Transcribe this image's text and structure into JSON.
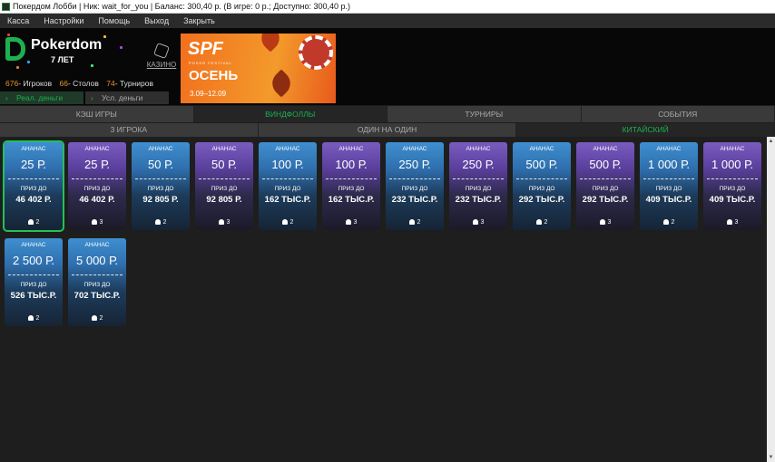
{
  "window": {
    "title": "Покердом Лобби | Ник: wait_for_you | Баланс: 300,40 р. (В игре: 0 р.; Доступно: 300,40 р.)"
  },
  "menu": [
    "Касса",
    "Настройки",
    "Помощь",
    "Выход",
    "Закрыть"
  ],
  "header": {
    "logo_text": "Pokerdom",
    "logo_sub": "7 ЛЕТ",
    "casino_label": "КАЗИНО",
    "stats": {
      "players_count": "676",
      "players_label": "- Игроков",
      "tables_count": "66",
      "tables_label": "- Столов",
      "tournaments_count": "74",
      "tournaments_label": "- Турниров"
    },
    "banner": {
      "title": "SPF",
      "fest": "POKER FESTIVAL",
      "season": "ОСЕНЬ",
      "dates": "3.09–12.09"
    }
  },
  "money_tabs": [
    {
      "label": "Реал. деньги",
      "active": true
    },
    {
      "label": "Усл. деньги",
      "active": false
    }
  ],
  "tabs": [
    {
      "label": "КЭШ ИГРЫ",
      "active": false
    },
    {
      "label": "ВИНДФОЛЛЫ",
      "active": true
    },
    {
      "label": "ТУРНИРЫ",
      "active": false
    },
    {
      "label": "СОБЫТИЯ",
      "active": false
    }
  ],
  "subtabs": [
    {
      "label": "3 ИГРОКА",
      "active": false
    },
    {
      "label": "ОДИН НА ОДИН",
      "active": false
    },
    {
      "label": "КИТАЙСКИЙ",
      "active": true
    }
  ],
  "prize_label": "ПРИЗ ДО",
  "cards": [
    {
      "game": "АНАНАС",
      "buyin": "25 Р.",
      "prize": "46 402 Р.",
      "players": "2",
      "color": "blue",
      "selected": true
    },
    {
      "game": "АНАНАС",
      "buyin": "25 Р.",
      "prize": "46 402 Р.",
      "players": "3",
      "color": "purple"
    },
    {
      "game": "АНАНАС",
      "buyin": "50 Р.",
      "prize": "92 805 Р.",
      "players": "2",
      "color": "blue"
    },
    {
      "game": "АНАНАС",
      "buyin": "50 Р.",
      "prize": "92 805 Р.",
      "players": "3",
      "color": "purple"
    },
    {
      "game": "АНАНАС",
      "buyin": "100 Р.",
      "prize": "162 ТЫС.Р.",
      "players": "2",
      "color": "blue"
    },
    {
      "game": "АНАНАС",
      "buyin": "100 Р.",
      "prize": "162 ТЫС.Р.",
      "players": "3",
      "color": "purple"
    },
    {
      "game": "АНАНАС",
      "buyin": "250 Р.",
      "prize": "232 ТЫС.Р.",
      "players": "2",
      "color": "blue"
    },
    {
      "game": "АНАНАС",
      "buyin": "250 Р.",
      "prize": "232 ТЫС.Р.",
      "players": "3",
      "color": "purple"
    },
    {
      "game": "АНАНАС",
      "buyin": "500 Р.",
      "prize": "292 ТЫС.Р.",
      "players": "2",
      "color": "blue"
    },
    {
      "game": "АНАНАС",
      "buyin": "500 Р.",
      "prize": "292 ТЫС.Р.",
      "players": "3",
      "color": "purple"
    },
    {
      "game": "АНАНАС",
      "buyin": "1 000 Р.",
      "prize": "409 ТЫС.Р.",
      "players": "2",
      "color": "blue"
    },
    {
      "game": "АНАНАС",
      "buyin": "1 000 Р.",
      "prize": "409 ТЫС.Р.",
      "players": "3",
      "color": "purple"
    },
    {
      "game": "АНАНАС",
      "buyin": "2 500 Р.",
      "prize": "526 ТЫС.Р.",
      "players": "2",
      "color": "blue"
    },
    {
      "game": "АНАНАС",
      "buyin": "5 000 Р.",
      "prize": "702 ТЫС.Р.",
      "players": "2",
      "color": "blue"
    }
  ],
  "colors": {
    "accent": "#1db04f",
    "stat_number": "#e8912a",
    "card_blue": "#3f8fd0",
    "card_purple": "#7a5cc0"
  }
}
